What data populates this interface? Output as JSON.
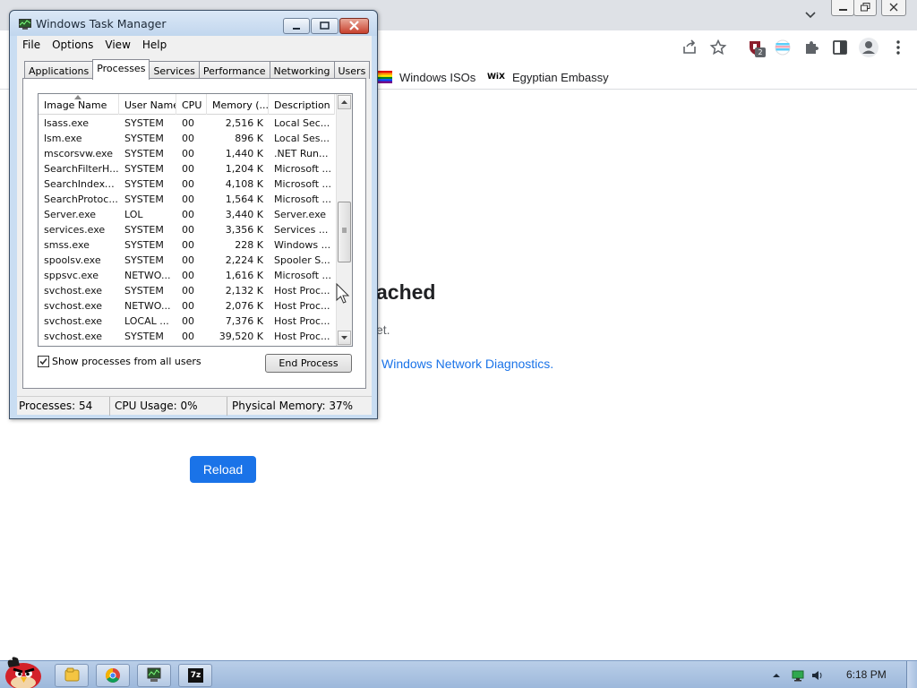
{
  "browser": {
    "bookmarks": [
      {
        "label": "Windows ISOs",
        "icon": "rainbow-flag-icon"
      },
      {
        "label": "Egyptian Embassy",
        "icon": "wix-icon"
      }
    ],
    "extension_badge": "2",
    "toolbar_icons": [
      "share-icon",
      "star-icon",
      "shield-extension-icon",
      "flag-extension-icon",
      "puzzle-icon",
      "sidepanel-icon",
      "profile-icon",
      "menu-icon"
    ]
  },
  "error_page": {
    "title_fragment": "ached",
    "subtitle_fragment": "et.",
    "diagnostics_link": "Windows Network Diagnostics.",
    "reload_label": "Reload",
    "accent": "#1a73e8"
  },
  "task_manager": {
    "title": "Windows Task Manager",
    "menus": [
      "File",
      "Options",
      "View",
      "Help"
    ],
    "tabs": [
      "Applications",
      "Processes",
      "Services",
      "Performance",
      "Networking",
      "Users"
    ],
    "active_tab": "Processes",
    "columns": [
      "Image Name",
      "User Name",
      "CPU",
      "Memory (...",
      "Description"
    ],
    "processes": [
      {
        "name": "lsass.exe",
        "user": "SYSTEM",
        "cpu": "00",
        "mem": "2,516 K",
        "desc": "Local Sec..."
      },
      {
        "name": "lsm.exe",
        "user": "SYSTEM",
        "cpu": "00",
        "mem": "896 K",
        "desc": "Local Ses..."
      },
      {
        "name": "mscorsvw.exe",
        "user": "SYSTEM",
        "cpu": "00",
        "mem": "1,440 K",
        "desc": ".NET Run..."
      },
      {
        "name": "SearchFilterH...",
        "user": "SYSTEM",
        "cpu": "00",
        "mem": "1,204 K",
        "desc": "Microsoft ..."
      },
      {
        "name": "SearchIndexe...",
        "user": "SYSTEM",
        "cpu": "00",
        "mem": "4,108 K",
        "desc": "Microsoft ..."
      },
      {
        "name": "SearchProtoc...",
        "user": "SYSTEM",
        "cpu": "00",
        "mem": "1,564 K",
        "desc": "Microsoft ..."
      },
      {
        "name": "Server.exe",
        "user": "LOL",
        "cpu": "00",
        "mem": "3,440 K",
        "desc": "Server.exe"
      },
      {
        "name": "services.exe",
        "user": "SYSTEM",
        "cpu": "00",
        "mem": "3,356 K",
        "desc": "Services ..."
      },
      {
        "name": "smss.exe",
        "user": "SYSTEM",
        "cpu": "00",
        "mem": "228 K",
        "desc": "Windows ..."
      },
      {
        "name": "spoolsv.exe",
        "user": "SYSTEM",
        "cpu": "00",
        "mem": "2,224 K",
        "desc": "Spooler S..."
      },
      {
        "name": "sppsvc.exe",
        "user": "NETWO...",
        "cpu": "00",
        "mem": "1,616 K",
        "desc": "Microsoft ..."
      },
      {
        "name": "svchost.exe",
        "user": "SYSTEM",
        "cpu": "00",
        "mem": "2,132 K",
        "desc": "Host Proc..."
      },
      {
        "name": "svchost.exe",
        "user": "NETWO...",
        "cpu": "00",
        "mem": "2,076 K",
        "desc": "Host Proc..."
      },
      {
        "name": "svchost.exe",
        "user": "LOCAL ...",
        "cpu": "00",
        "mem": "7,376 K",
        "desc": "Host Proc..."
      },
      {
        "name": "svchost.exe",
        "user": "SYSTEM",
        "cpu": "00",
        "mem": "39,520 K",
        "desc": "Host Proc..."
      }
    ],
    "show_all_users_label": "Show processes from all users",
    "show_all_users_checked": true,
    "end_process_label": "End Process",
    "status": {
      "processes": "Processes: 54",
      "cpu": "CPU Usage: 0%",
      "memory": "Physical Memory: 37%"
    }
  },
  "taskbar": {
    "apps": [
      "explorer-icon",
      "chrome-icon",
      "task-manager-icon",
      "7zip-icon"
    ],
    "tray_icons": [
      "show-hidden-icons-icon",
      "network-icon",
      "volume-icon"
    ],
    "clock": "6:18 PM",
    "zip_label": "7z"
  }
}
